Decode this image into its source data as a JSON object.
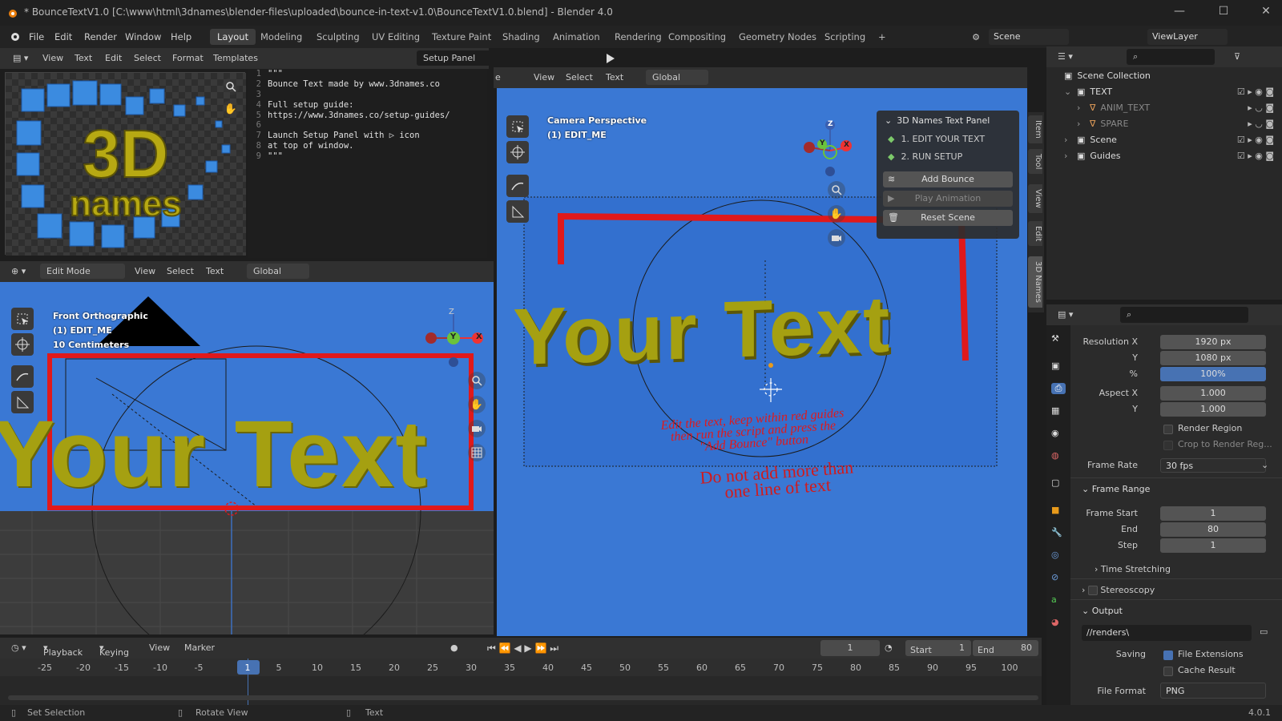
{
  "titlebar": {
    "title": "* BounceTextV1.0 [C:\\www\\html\\3dnames\\blender-files\\uploaded\\bounce-in-text-v1.0\\BounceTextV1.0.blend] - Blender 4.0",
    "min": "—",
    "max": "☐",
    "close": "✕"
  },
  "menu": {
    "items": [
      "File",
      "Edit",
      "Render",
      "Window",
      "Help"
    ],
    "workspaces": [
      "Layout",
      "Modeling",
      "Sculpting",
      "UV Editing",
      "Texture Paint",
      "Shading",
      "Animation",
      "Rendering",
      "Compositing",
      "Geometry Nodes",
      "Scripting"
    ],
    "add_tab": "+",
    "scene": "Scene",
    "view_layer": "ViewLayer"
  },
  "text_editor": {
    "menus": [
      "View",
      "Text",
      "Edit",
      "Select",
      "Format",
      "Templates"
    ],
    "file_name": "Setup Panel",
    "lines": [
      {
        "n": "1",
        "t": "\"\"\""
      },
      {
        "n": "2",
        "t": "Bounce Text made by www.3dnames.co"
      },
      {
        "n": "3",
        "t": ""
      },
      {
        "n": "4",
        "t": "Full setup guide:"
      },
      {
        "n": "5",
        "t": "https://www.3dnames.co/setup-guides/"
      },
      {
        "n": "6",
        "t": ""
      },
      {
        "n": "7",
        "t": "Launch Setup Panel with ▷ icon"
      },
      {
        "n": "8",
        "t": "at top of window."
      },
      {
        "n": "9",
        "t": "\"\"\""
      }
    ],
    "logo_line1": "3D",
    "logo_line2": "names"
  },
  "front_view": {
    "mode": "Edit Mode",
    "menus": [
      "View",
      "Select",
      "Text"
    ],
    "orientation": "Global",
    "overlay_title": "Front Orthographic",
    "overlay_obj": "(1) EDIT_ME",
    "overlay_scale": "10 Centimeters",
    "text3d": "Your Text",
    "axis_z": "Z",
    "axis_y": "Y",
    "axis_x": "X"
  },
  "camera_view": {
    "menus": [
      "View",
      "Select",
      "Text"
    ],
    "orientation": "Global",
    "overlay_title": "Camera Perspective",
    "overlay_obj": "(1) EDIT_ME",
    "text3d": "Your Text",
    "note1": "Edit the text, keep within red guides",
    "note2": "then run the script and press the",
    "note3": "\"Add Bounce\" button",
    "note4": "Do not add more than",
    "note5": "one line of text",
    "axis_z": "Z",
    "axis_y": "Y",
    "axis_x": "X",
    "side_tabs": [
      "Item",
      "Tool",
      "View",
      "Edit",
      "3D Names"
    ],
    "left_edge_char": "e"
  },
  "names_panel": {
    "title": "3D Names Text Panel",
    "step1": "1. EDIT YOUR TEXT",
    "step2": "2. RUN SETUP",
    "add_bounce": "Add Bounce",
    "play_animation": "Play Animation",
    "reset_scene": "Reset Scene"
  },
  "outliner": {
    "root": "Scene Collection",
    "items": [
      {
        "name": "TEXT",
        "indent": 1
      },
      {
        "name": "ANIM_TEXT",
        "indent": 2
      },
      {
        "name": "SPARE",
        "indent": 2
      },
      {
        "name": "Scene",
        "indent": 1
      },
      {
        "name": "Guides",
        "indent": 1
      }
    ]
  },
  "properties": {
    "resolution_x_label": "Resolution X",
    "resolution_x": "1920 px",
    "resolution_y_label": "Y",
    "resolution_y": "1080 px",
    "percent_label": "%",
    "percent": "100%",
    "aspect_x_label": "Aspect X",
    "aspect_x": "1.000",
    "aspect_y_label": "Y",
    "aspect_y": "1.000",
    "render_region": "Render Region",
    "crop_region": "Crop to Render Reg...",
    "frame_rate_label": "Frame Rate",
    "frame_rate": "30 fps",
    "frame_range": "Frame Range",
    "frame_start_label": "Frame Start",
    "frame_start": "1",
    "frame_end_label": "End",
    "frame_end": "80",
    "frame_step_label": "Step",
    "frame_step": "1",
    "time_stretching": "Time Stretching",
    "stereoscopy": "Stereoscopy",
    "output": "Output",
    "output_path": "//renders\\",
    "saving_label": "Saving",
    "file_extensions": "File Extensions",
    "cache_result": "Cache Result",
    "file_format_label": "File Format",
    "file_format": "PNG"
  },
  "timeline": {
    "menus": [
      "Playback",
      "Keying",
      "View",
      "Marker"
    ],
    "current_frame": "1",
    "start_label": "Start",
    "start": "1",
    "end_label": "End",
    "end": "80",
    "ticks": [
      "-25",
      "-20",
      "-15",
      "-10",
      "-5",
      "1",
      "5",
      "10",
      "15",
      "20",
      "25",
      "30",
      "35",
      "40",
      "45",
      "50",
      "55",
      "60",
      "65",
      "70",
      "75",
      "80",
      "85",
      "90",
      "95",
      "100"
    ]
  },
  "status": {
    "left": "Set Selection",
    "mid": "Rotate View",
    "right": "Text",
    "version": "4.0.1"
  },
  "colors": {
    "viewport_blue": "#3a78d4",
    "guide_red": "#e0191b",
    "text_gold": "#a5a011"
  }
}
